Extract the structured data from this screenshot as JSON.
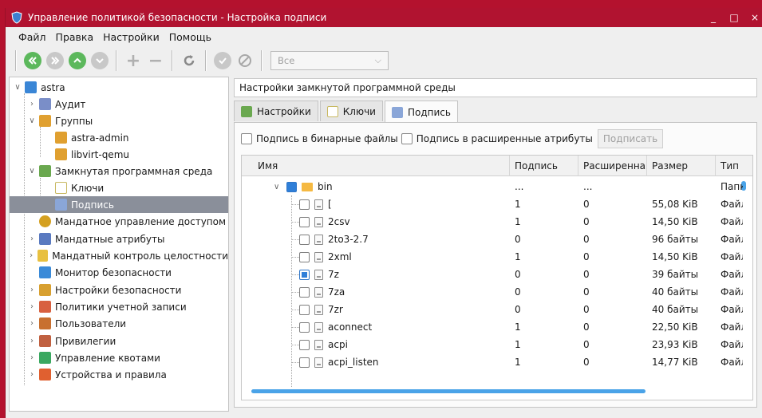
{
  "window": {
    "title": "Управление политикой безопасности - Настройка подписи",
    "controls": [
      "_",
      "□",
      "×"
    ]
  },
  "menubar": [
    "Файл",
    "Правка",
    "Настройки",
    "Помощь"
  ],
  "toolbar": {
    "filter_value": "Все"
  },
  "tree": [
    {
      "label": "astra",
      "icon": "computer-icon",
      "color": "#3a86d6"
    },
    {
      "label": "Аудит",
      "icon": "audit-icon",
      "color": "#7a8ec8"
    },
    {
      "label": "Группы",
      "icon": "group-icon",
      "color": "#e0a030"
    },
    {
      "label": "astra-admin",
      "icon": "group-icon",
      "color": "#e0a030"
    },
    {
      "label": "libvirt-qemu",
      "icon": "group-icon",
      "color": "#e0a030"
    },
    {
      "label": "Замкнутая программная среда",
      "icon": "closed-env-icon",
      "color": "#6aa84f"
    },
    {
      "label": "Ключи",
      "icon": "key-icon",
      "color": "#d8c66a"
    },
    {
      "label": "Подпись",
      "icon": "signature-icon",
      "color": "#8aa6d8"
    },
    {
      "label": "Мандатное управление доступом",
      "icon": "mandatory-access-icon",
      "color": "#d4a020"
    },
    {
      "label": "Мандатные атрибуты",
      "icon": "mandatory-attributes-icon",
      "color": "#5a7ac0"
    },
    {
      "label": "Мандатный контроль целостности",
      "icon": "integrity-icon",
      "color": "#e8c040"
    },
    {
      "label": "Монитор безопасности",
      "icon": "monitor-icon",
      "color": "#3a8ad8"
    },
    {
      "label": "Настройки безопасности",
      "icon": "security-settings-icon",
      "color": "#d8a030"
    },
    {
      "label": "Политики учетной записи",
      "icon": "account-policy-icon",
      "color": "#d86040"
    },
    {
      "label": "Пользователи",
      "icon": "users-icon",
      "color": "#c87030"
    },
    {
      "label": "Привилегии",
      "icon": "privileges-icon",
      "color": "#c06040"
    },
    {
      "label": "Управление квотами",
      "icon": "quota-icon",
      "color": "#3aa860"
    },
    {
      "label": "Устройства и правила",
      "icon": "devices-icon",
      "color": "#e06030"
    }
  ],
  "panel": {
    "header": "Настройки замкнутой программной среды",
    "tabs": [
      {
        "label": "Настройки",
        "icon": "settings-tab-icon",
        "color": "#6aa84f"
      },
      {
        "label": "Ключи",
        "icon": "key-tab-icon",
        "color": "#d8c66a"
      },
      {
        "label": "Подпись",
        "icon": "signature-tab-icon",
        "color": "#8aa6d8"
      }
    ],
    "opt_binary": "Подпись в бинарные файлы",
    "opt_extended": "Подпись в расширенные атрибуты",
    "sign_button": "Подписать"
  },
  "table": {
    "columns": [
      "Имя",
      "Подпись",
      "Расширенная",
      "Размер",
      "Тип"
    ],
    "folder": {
      "name": "bin",
      "signature": "...",
      "extended": "...",
      "size": "",
      "type": "Папка"
    },
    "rows": [
      {
        "name": "[",
        "signature": "1",
        "extended": "0",
        "size": "55,08 KiB",
        "type": "Файл",
        "checked": false
      },
      {
        "name": "2csv",
        "signature": "1",
        "extended": "0",
        "size": "14,50 KiB",
        "type": "Файл",
        "checked": false
      },
      {
        "name": "2to3-2.7",
        "signature": "0",
        "extended": "0",
        "size": "96 байты",
        "type": "Файл",
        "checked": false
      },
      {
        "name": "2xml",
        "signature": "1",
        "extended": "0",
        "size": "14,50 KiB",
        "type": "Файл",
        "checked": false
      },
      {
        "name": "7z",
        "signature": "0",
        "extended": "0",
        "size": "39 байты",
        "type": "Файл",
        "checked": true
      },
      {
        "name": "7za",
        "signature": "0",
        "extended": "0",
        "size": "40 байты",
        "type": "Файл",
        "checked": false
      },
      {
        "name": "7zr",
        "signature": "0",
        "extended": "0",
        "size": "40 байты",
        "type": "Файл",
        "checked": false
      },
      {
        "name": "aconnect",
        "signature": "1",
        "extended": "0",
        "size": "22,50 KiB",
        "type": "Файл",
        "checked": false
      },
      {
        "name": "acpi",
        "signature": "1",
        "extended": "0",
        "size": "23,93 KiB",
        "type": "Файл",
        "checked": false
      },
      {
        "name": "acpi_listen",
        "signature": "1",
        "extended": "0",
        "size": "14,77 KiB",
        "type": "Файл",
        "checked": false
      }
    ]
  }
}
